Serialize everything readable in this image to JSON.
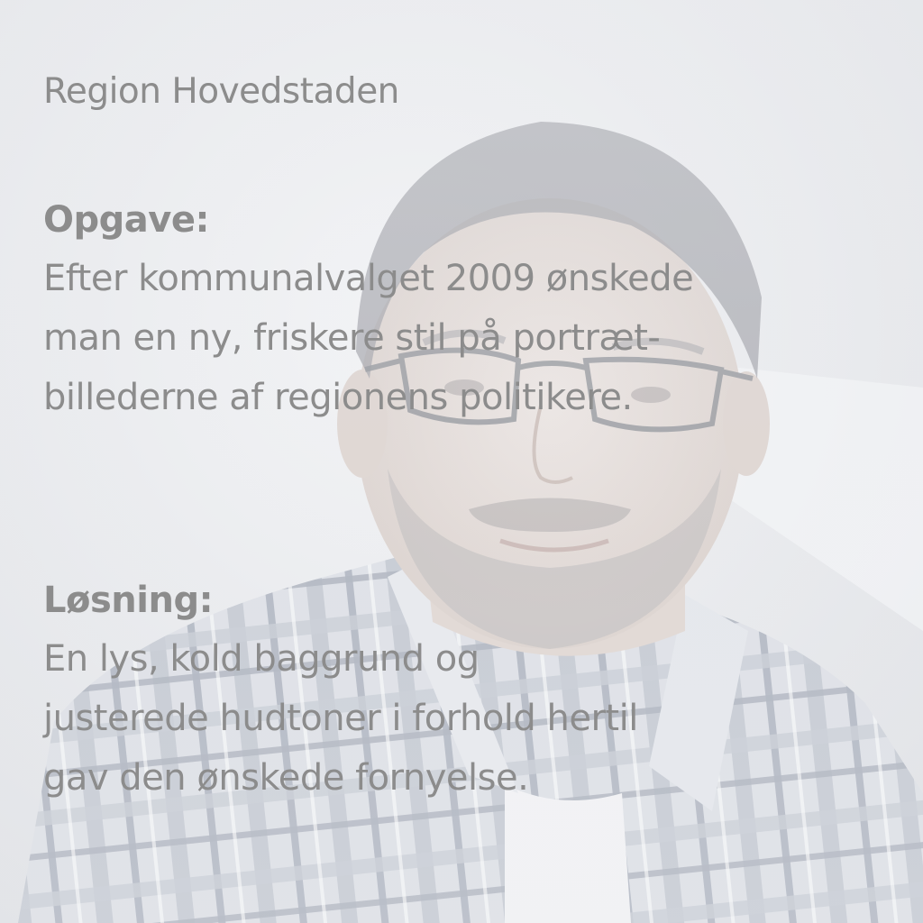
{
  "client": "Region Hovedstaden",
  "task": {
    "heading": "Opgave:",
    "lines": [
      "Efter kommunalvalget 2009 ønskede",
      "man en ny, friskere stil på portræt-",
      "billederne af regionens politikere."
    ]
  },
  "solution": {
    "heading": "Løsning:",
    "lines": [
      "En lys, kold baggrund og",
      "justerede hudtoner i forhold hertil",
      "gav den ønskede fornyelse."
    ]
  },
  "background_photo": {
    "subject": "faded portrait of a man with glasses and plaid shirt",
    "colors": {
      "backdrop": "#e9eaed",
      "hair": "#9c9ea4",
      "skin": "#e2d8d3",
      "shirt_light": "#dde0e6",
      "shirt_dark": "#a9afbb",
      "text": "#8c8c8c"
    }
  }
}
